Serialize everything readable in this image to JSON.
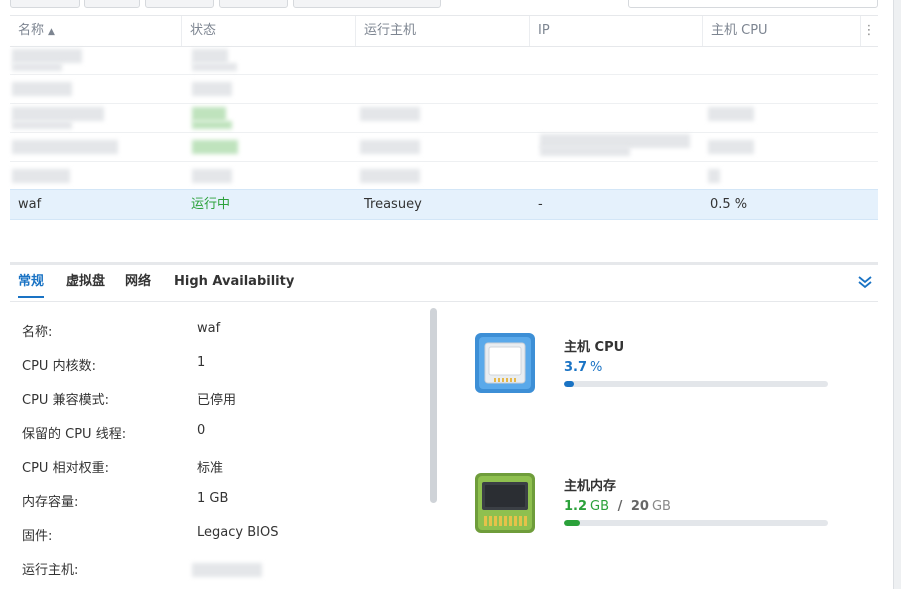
{
  "grid": {
    "columns": [
      {
        "label": "名称",
        "sort": "▲"
      },
      {
        "label": "状态"
      },
      {
        "label": "运行主机"
      },
      {
        "label": "IP"
      },
      {
        "label": "主机 CPU"
      }
    ],
    "column_menu_icon": "⋮",
    "selected_row": {
      "name": "waf",
      "status": "运行中",
      "host": "Treasuey",
      "ip": "-",
      "cpu": "0.5 %"
    },
    "status_color": "#2ba13a",
    "selection_color": "#e5f1fc"
  },
  "tabs": [
    {
      "label": "常规",
      "active": true
    },
    {
      "label": "虚拟盘"
    },
    {
      "label": "网络"
    },
    {
      "label": "High Availability"
    }
  ],
  "collapse_icon": "double-chevron-down-icon",
  "details": [
    {
      "label": "名称:",
      "value": "waf"
    },
    {
      "label": "CPU 内核数:",
      "value": "1"
    },
    {
      "label": "CPU 兼容模式:",
      "value": "已停用"
    },
    {
      "label": "保留的 CPU 线程:",
      "value": "0"
    },
    {
      "label": "CPU 相对权重:",
      "value": "标准"
    },
    {
      "label": "内存容量:",
      "value": "1 GB"
    },
    {
      "label": "固件:",
      "value": "Legacy BIOS"
    },
    {
      "label": "运行主机:",
      "value": ""
    }
  ],
  "resources": {
    "cpu": {
      "title": "主机 CPU",
      "value": "3.7",
      "unit": "%",
      "percent": 3.7,
      "color": "#1a73c4",
      "icon": "cpu-chip-icon"
    },
    "memory": {
      "title": "主机内存",
      "used": "1.2",
      "used_unit": "GB",
      "separator": "/",
      "total": "20",
      "total_unit": "GB",
      "fraction": 0.06,
      "color": "#2ba13a",
      "icon": "memory-module-icon"
    }
  },
  "accent": "#1a73c4"
}
